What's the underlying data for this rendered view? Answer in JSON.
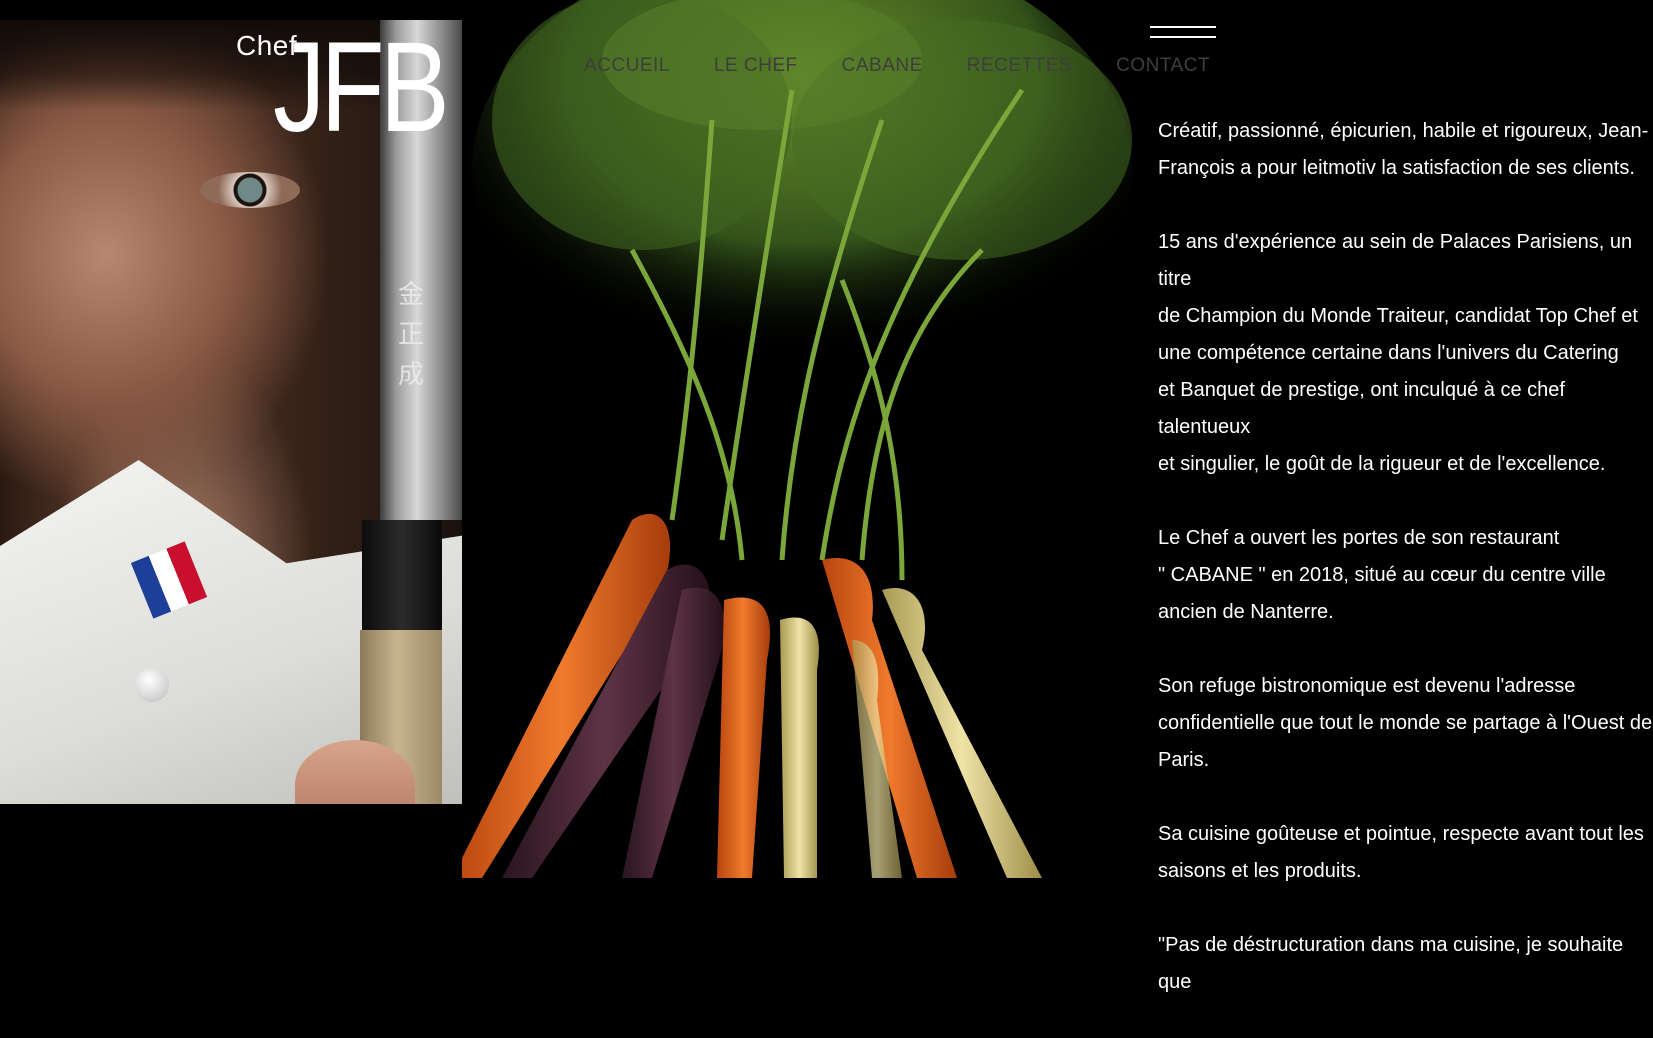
{
  "logo": {
    "small": "Chef",
    "large": "JFB"
  },
  "nav": {
    "items": [
      {
        "label": "ACCUEIL"
      },
      {
        "label": "LE CHEF"
      },
      {
        "label": "CABANE"
      },
      {
        "label": "RECETTES"
      },
      {
        "label": "CONTACT"
      }
    ]
  },
  "menu_icon": "hamburger-icon",
  "knife_kanji": "金\n正\n成",
  "bio": {
    "paragraphs": [
      "Créatif, passionné, épicurien, habile et rigoureux, Jean-\nFrançois a pour leitmotiv la satisfaction de ses clients.",
      "15 ans d'expérience au sein de Palaces Parisiens, un titre\nde Champion du Monde Traiteur, candidat Top Chef et\nune compétence certaine dans l'univers du Catering\net Banquet de prestige, ont inculqué à ce chef talentueux\net singulier, le goût de la rigueur et de l'excellence.",
      "Le Chef a ouvert les portes de son restaurant\n\" CABANE \" en 2018, situé au cœur du centre ville\nancien de Nanterre.",
      "Son refuge bistronomique est devenu l'adresse\nconfidentielle que tout le monde se partage à l'Ouest de\nParis.",
      "Sa cuisine goûteuse et pointue, respecte avant tout les\nsaisons et les produits.",
      "\"Pas de déstructuration dans ma cuisine, je souhaite que"
    ]
  },
  "colors": {
    "background": "#000000",
    "text": "#ffffff",
    "nav_text": "#3e3e3e"
  }
}
